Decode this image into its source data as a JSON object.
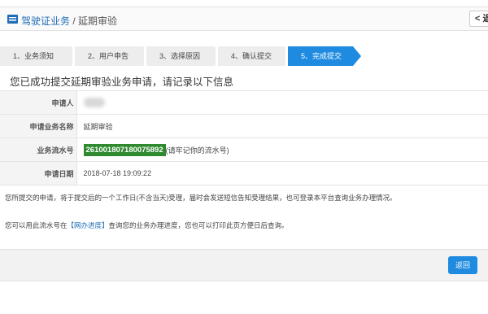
{
  "header": {
    "title": "驾驶证业务",
    "separator": "/",
    "subtitle": "延期审验",
    "back_label": "< 返"
  },
  "steps": [
    {
      "label": "1、业务须知",
      "active": false
    },
    {
      "label": "2、用户申告",
      "active": false
    },
    {
      "label": "3、选择原因",
      "active": false
    },
    {
      "label": "4、确认提交",
      "active": false
    },
    {
      "label": "5、完成提交",
      "active": true
    }
  ],
  "success_message": "您已成功提交延期审验业务申请，请记录以下信息",
  "info": {
    "applicant_label": "申请人",
    "business_name_label": "申请业务名称",
    "business_name_value": "延期审验",
    "serial_label": "业务流水号",
    "serial_value": "261001807180075892",
    "serial_hint": "(请牢记你的流水号)",
    "date_label": "申请日期",
    "date_value": "2018-07-18 19:09:22"
  },
  "notice_text": "您所提交的申请，将于提交后的一个工作日(不含当天)受理，届时会发送短信告知受理结果，也可登录本平台查询业务办理情况。",
  "notice2": {
    "before": "您可以用此流水号在",
    "link": "【网办进度】",
    "after": "查询您的业务办理进度，您也可以打印此页方便日后查询。"
  },
  "footer": {
    "return_label": "返回"
  },
  "colors": {
    "brand_blue": "#1f6db6",
    "active_step": "#1e8be0",
    "serial_green": "#2f8a2f"
  }
}
